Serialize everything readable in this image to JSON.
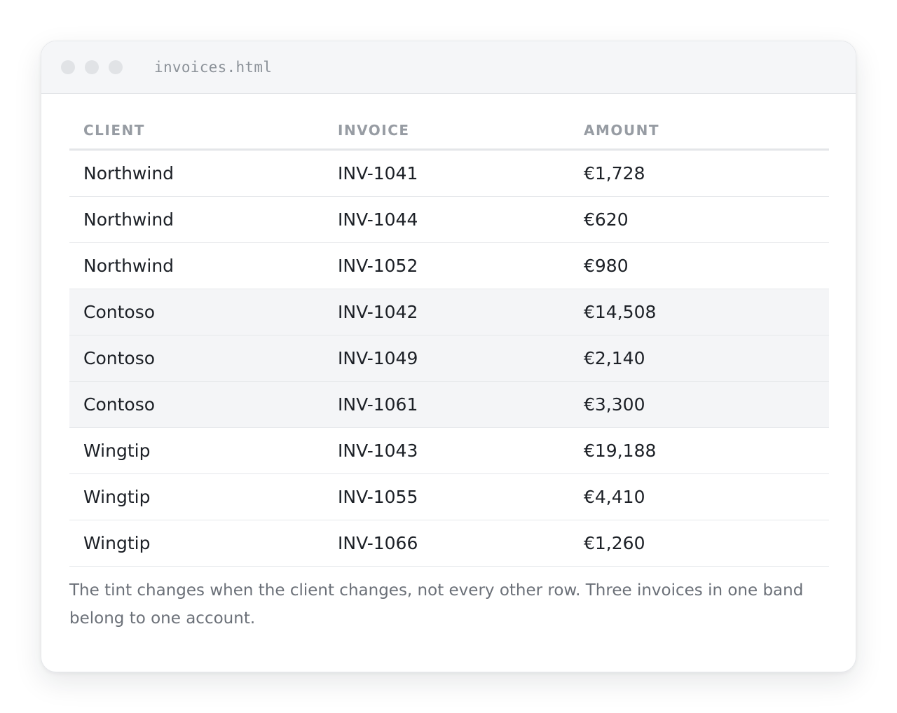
{
  "window": {
    "filename": "invoices.html"
  },
  "table": {
    "headers": {
      "client": "CLIENT",
      "invoice": "INVOICE",
      "amount": "AMOUNT"
    },
    "rows": [
      {
        "client": "Northwind",
        "invoice": "INV-1041",
        "amount": "€1,728",
        "tinted": false
      },
      {
        "client": "Northwind",
        "invoice": "INV-1044",
        "amount": "€620",
        "tinted": false
      },
      {
        "client": "Northwind",
        "invoice": "INV-1052",
        "amount": "€980",
        "tinted": false
      },
      {
        "client": "Contoso",
        "invoice": "INV-1042",
        "amount": "€14,508",
        "tinted": true
      },
      {
        "client": "Contoso",
        "invoice": "INV-1049",
        "amount": "€2,140",
        "tinted": true
      },
      {
        "client": "Contoso",
        "invoice": "INV-1061",
        "amount": "€3,300",
        "tinted": true
      },
      {
        "client": "Wingtip",
        "invoice": "INV-1043",
        "amount": "€19,188",
        "tinted": false
      },
      {
        "client": "Wingtip",
        "invoice": "INV-1055",
        "amount": "€4,410",
        "tinted": false
      },
      {
        "client": "Wingtip",
        "invoice": "INV-1066",
        "amount": "€1,260",
        "tinted": false
      }
    ]
  },
  "note": "The tint changes when the client changes, not every other row. Three invoices in one band belong to one account.",
  "colors": {
    "band_tint": "#f4f5f7",
    "text": "#1c2026",
    "header_text": "#979ca3",
    "muted_text": "#6b7078"
  }
}
